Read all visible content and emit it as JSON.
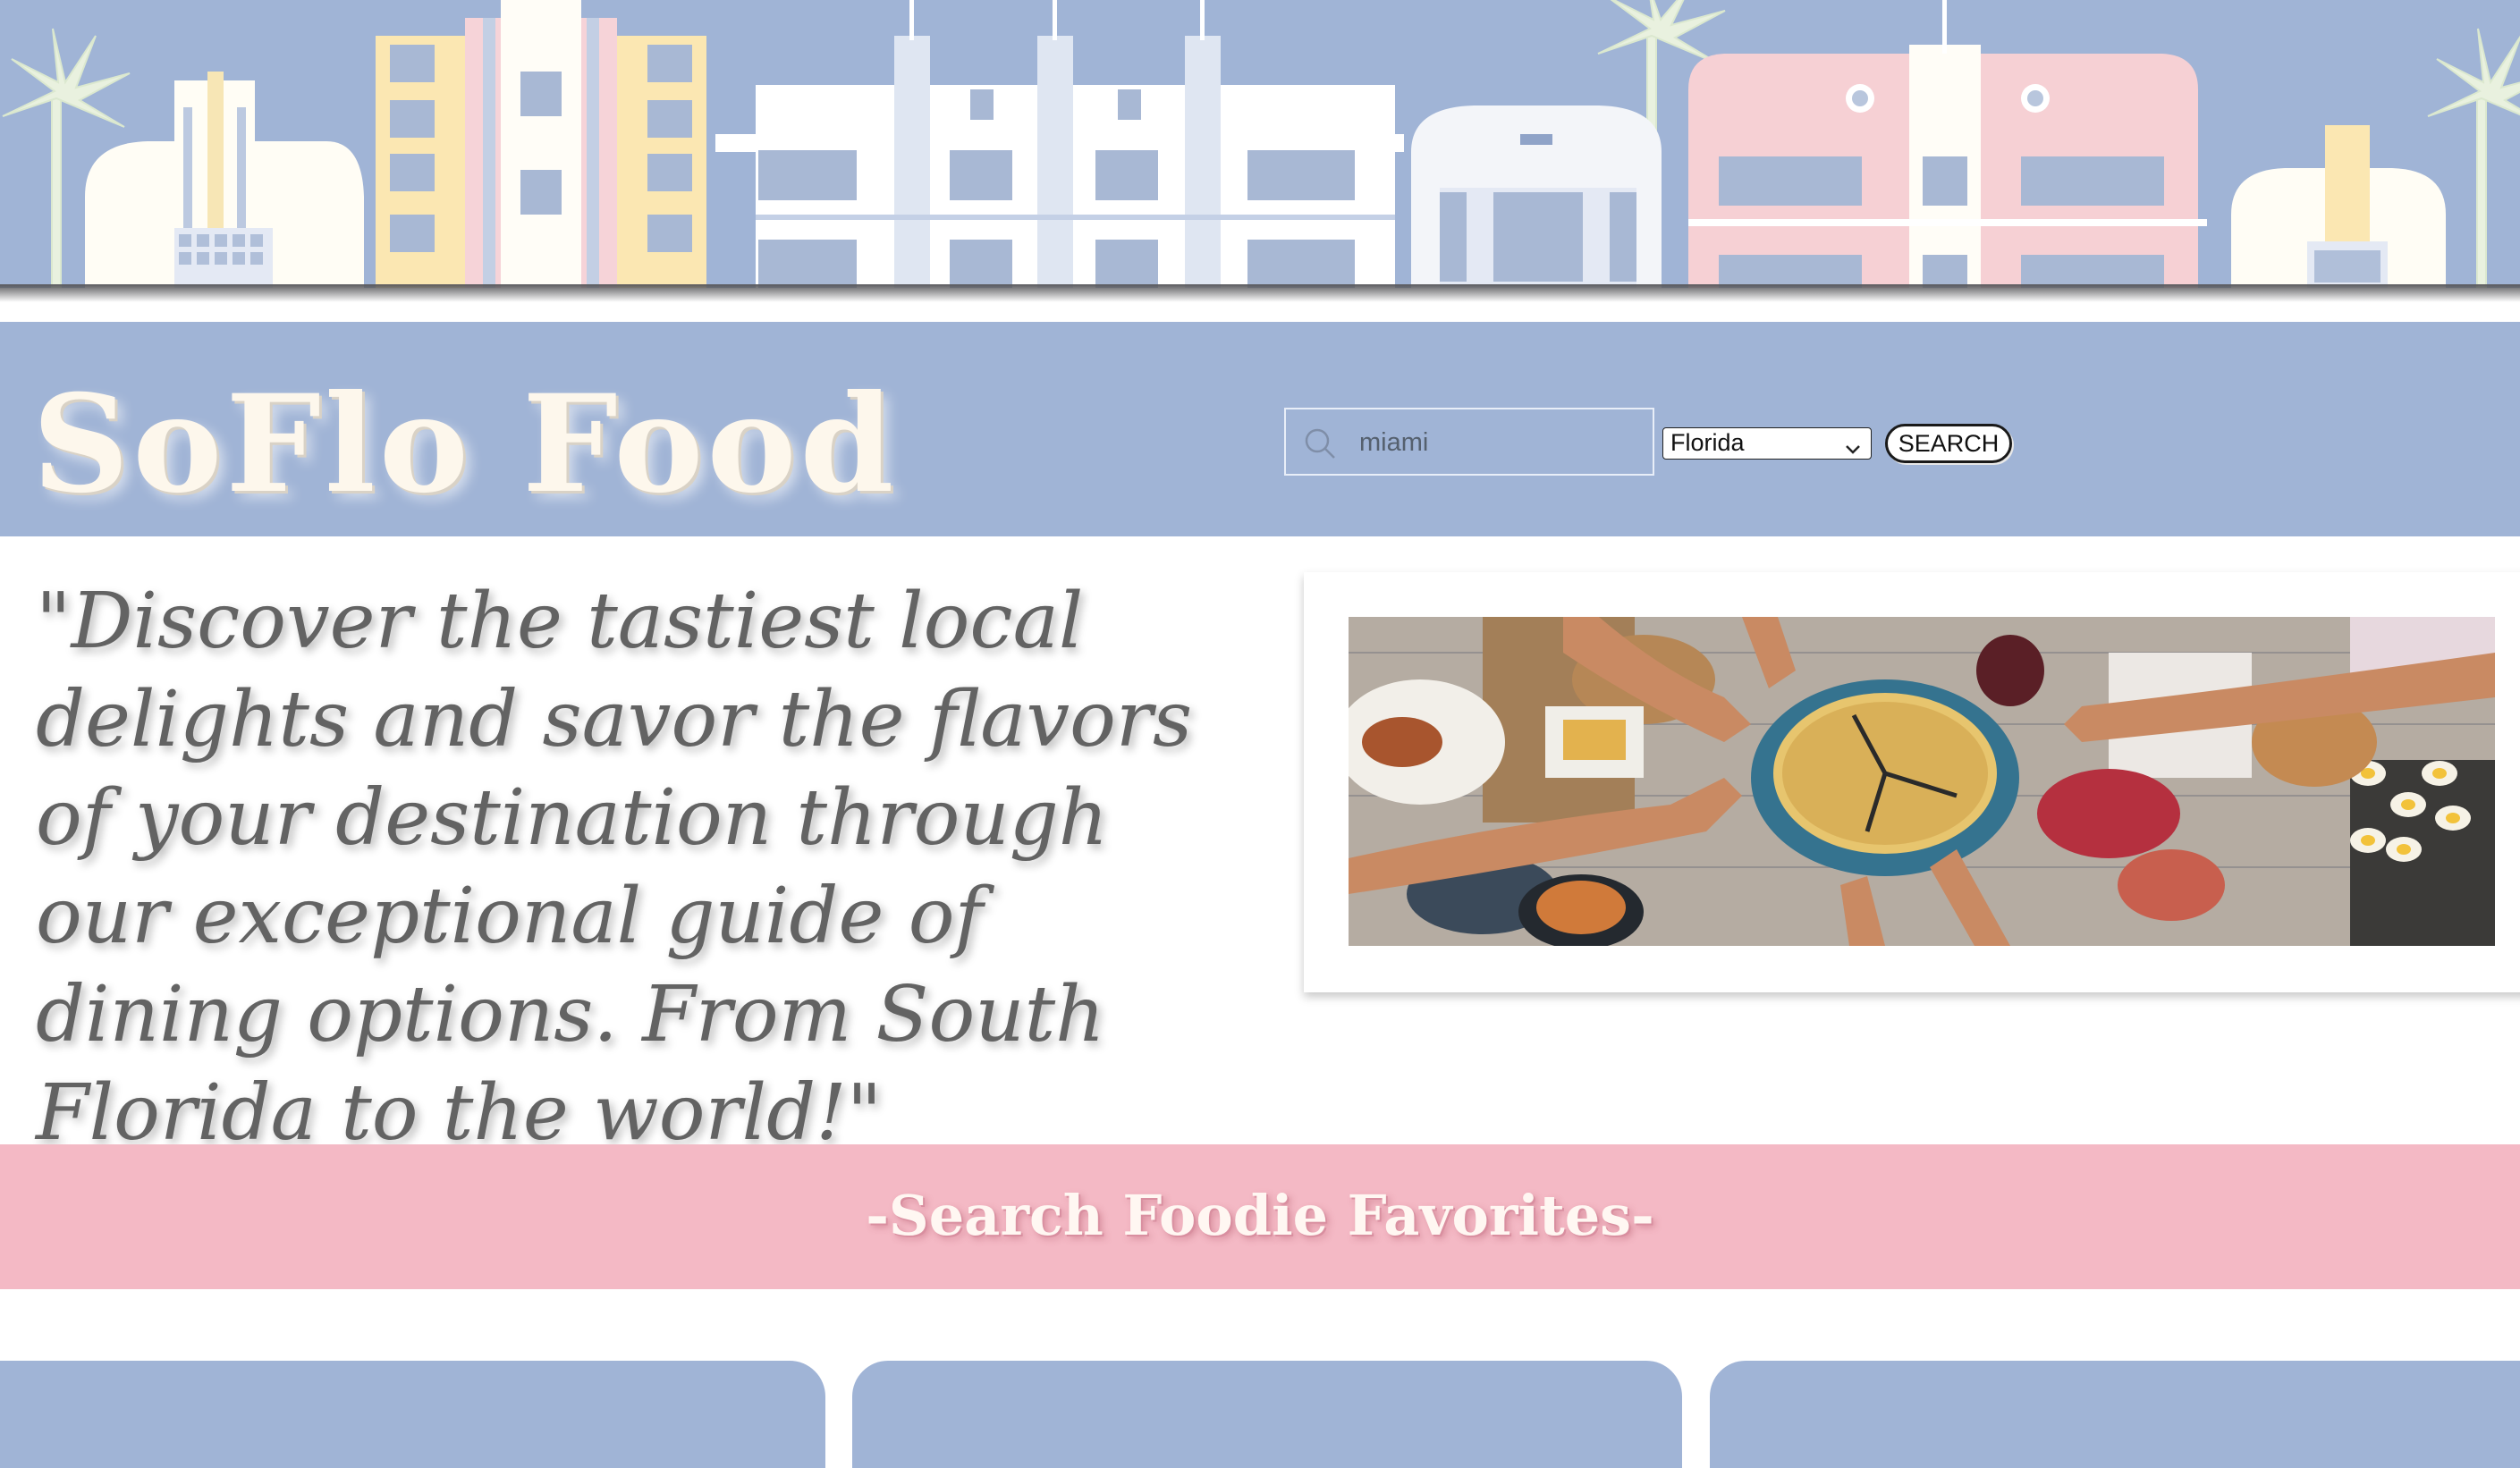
{
  "header": {
    "site_title": "SoFlo Food",
    "search": {
      "value": "miami",
      "icon": "search-icon"
    },
    "state_select": {
      "selected": "Florida",
      "icon": "chevron-down-icon"
    },
    "search_button_label": "SEARCH"
  },
  "hero": {
    "quote": "\"Discover the tastiest local delights and savor the flavors of your destination through our exceptional guide of dining options. From South Florida to the world!\""
  },
  "favorites": {
    "heading": "-Search Foodie Favorites-"
  },
  "colors": {
    "header_blue": "#a0b4d6",
    "banner_pink": "#f4b9c5",
    "title_cream": "#fdf7ec",
    "quote_gray": "#636363"
  }
}
